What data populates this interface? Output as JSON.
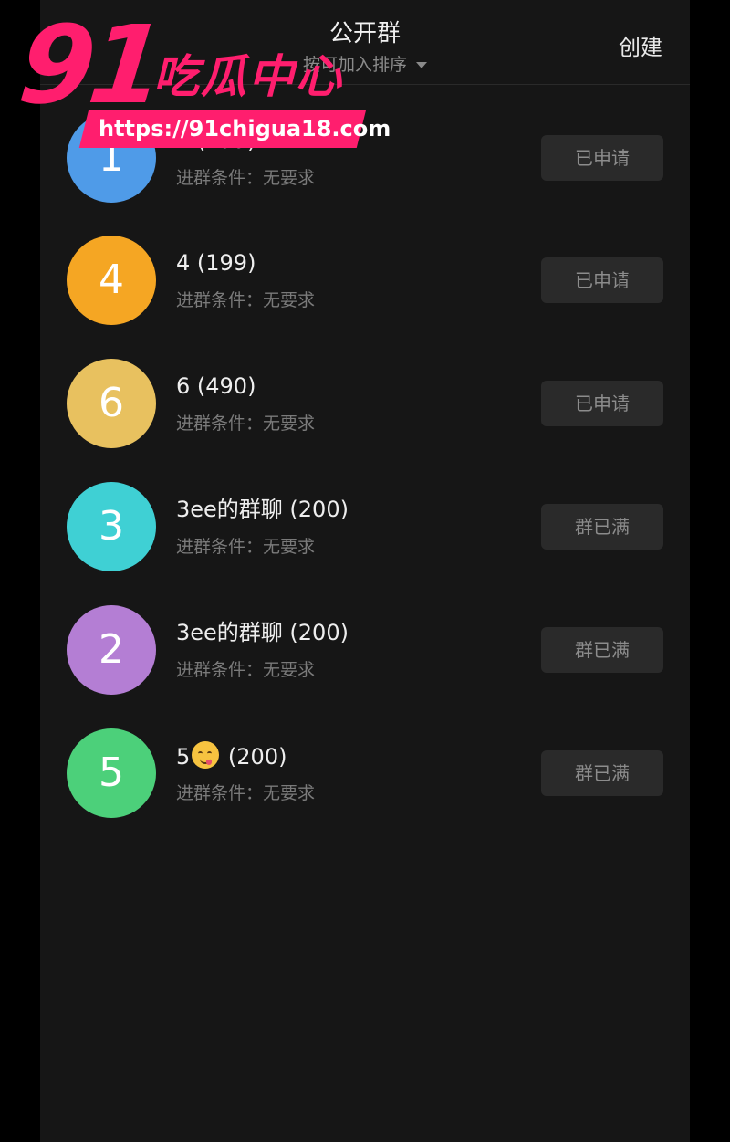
{
  "header": {
    "title": "公开群",
    "sort_label": "按可加入排序",
    "create_label": "创建"
  },
  "groups": [
    {
      "avatar_text": "1",
      "avatar_color": "#4f9be8",
      "name": "1 (199)",
      "condition": "进群条件：无要求",
      "status": "已申请"
    },
    {
      "avatar_text": "4",
      "avatar_color": "#f5a623",
      "name": "4 (199)",
      "condition": "进群条件：无要求",
      "status": "已申请"
    },
    {
      "avatar_text": "6",
      "avatar_color": "#e8c15f",
      "name": "6 (490)",
      "condition": "进群条件：无要求",
      "status": "已申请"
    },
    {
      "avatar_text": "3",
      "avatar_color": "#3fd0d4",
      "name": "3ee的群聊 (200)",
      "condition": "进群条件：无要求",
      "status": "群已满"
    },
    {
      "avatar_text": "2",
      "avatar_color": "#b47ed4",
      "name": "3ee的群聊 (200)",
      "condition": "进群条件：无要求",
      "status": "群已满"
    },
    {
      "avatar_text": "5",
      "avatar_color": "#4cd07a",
      "name_prefix": "5",
      "name_emoji": "face-savoring-food-emoji",
      "name_suffix": " (200)",
      "condition": "进群条件：无要求",
      "status": "群已满"
    }
  ],
  "watermark": {
    "number": "91",
    "text": "吃瓜中心",
    "url": "https://91chigua18.com",
    "color": "#ff1e6e"
  }
}
